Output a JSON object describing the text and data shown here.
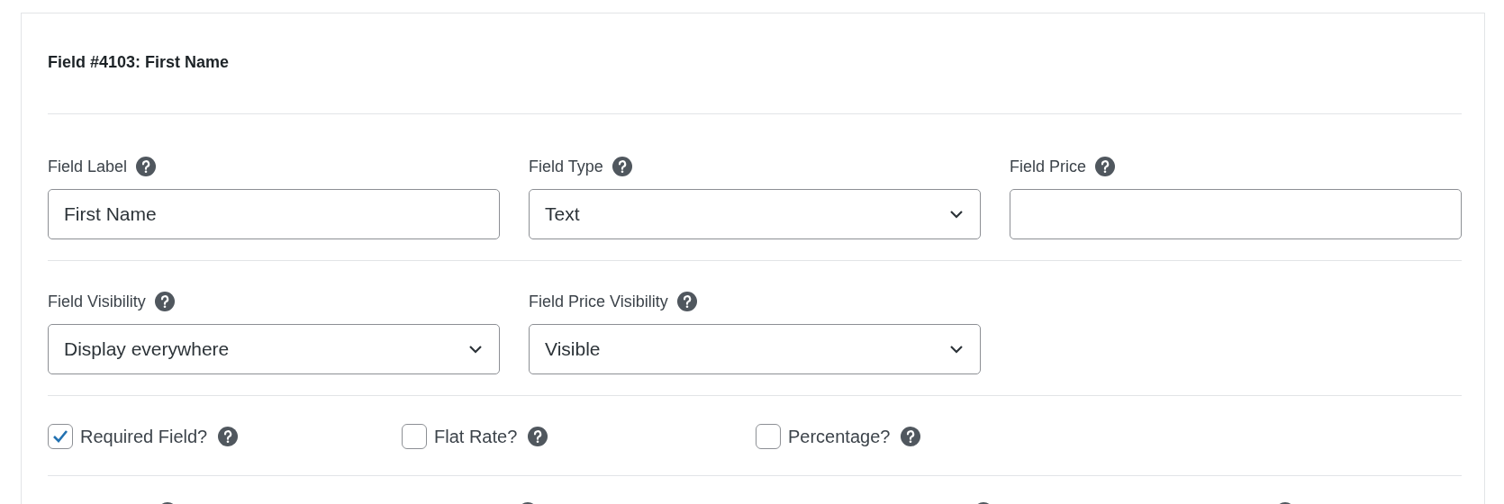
{
  "title": "Field #4103: First Name",
  "field_rows": [
    [
      {
        "label": "Field Label",
        "kind": "text",
        "value": "First Name"
      },
      {
        "label": "Field Type",
        "kind": "select",
        "value": "Text"
      },
      {
        "label": "Field Price",
        "kind": "text"
      }
    ],
    [
      {
        "label": "Field Visibility",
        "kind": "select",
        "value": "Display everywhere"
      },
      {
        "label": "Field Price Visibility",
        "kind": "select",
        "value": "Visible"
      }
    ]
  ],
  "options": [
    {
      "label": "Required Field?",
      "checked": true
    },
    {
      "label": "Flat Rate?",
      "checked": false
    },
    {
      "label": "Percentage?",
      "checked": false
    }
  ]
}
